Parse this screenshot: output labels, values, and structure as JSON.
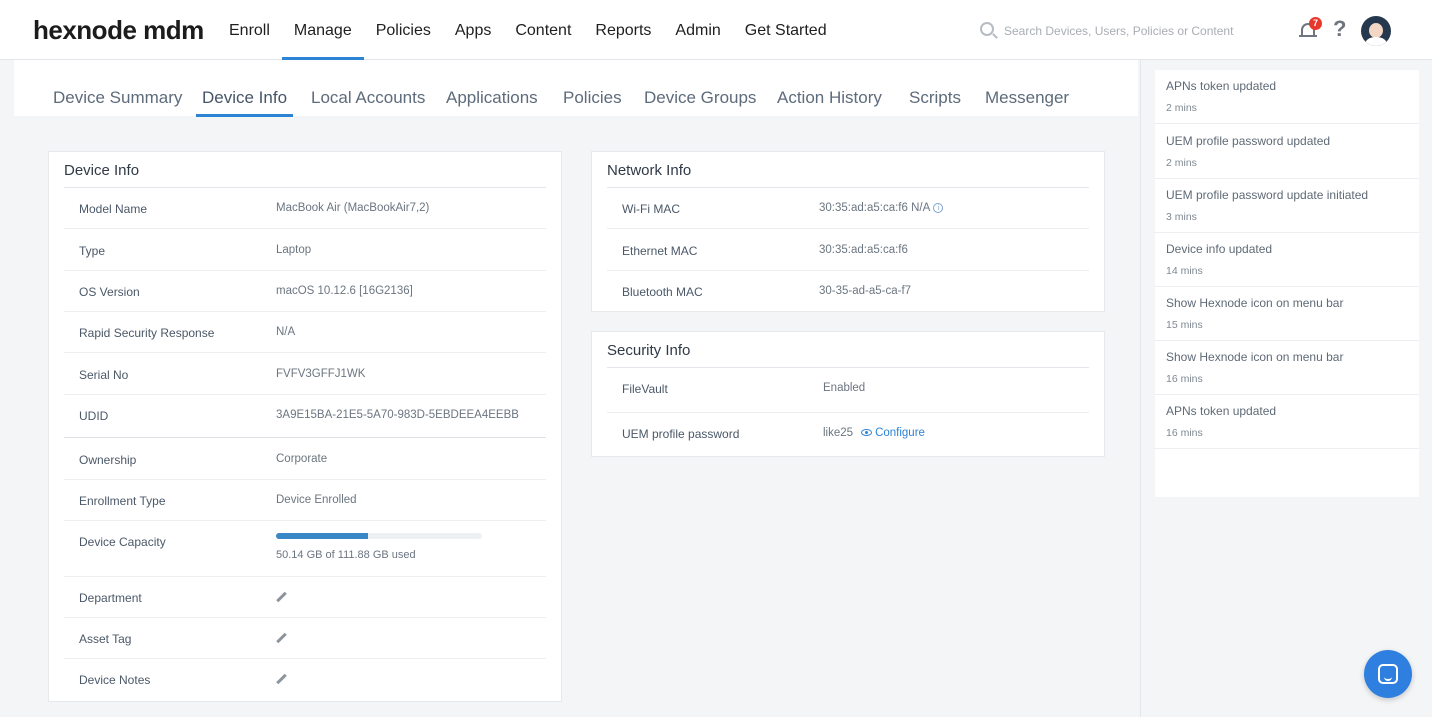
{
  "app": {
    "logo": "hexnode mdm"
  },
  "nav": {
    "items": [
      "Enroll",
      "Manage",
      "Policies",
      "Apps",
      "Content",
      "Reports",
      "Admin",
      "Get Started"
    ],
    "active": "Manage"
  },
  "search": {
    "placeholder": "Search Devices, Users, Policies or Content"
  },
  "header": {
    "notification_count": "7",
    "help": "?"
  },
  "tabs": [
    "Device Summary",
    "Device Info",
    "Local Accounts",
    "Applications",
    "Policies",
    "Device Groups",
    "Action History",
    "Scripts",
    "Messenger"
  ],
  "active_tab": "Device Info",
  "device_info": {
    "title": "Device Info",
    "rows": [
      {
        "label": "Model Name",
        "value": "MacBook Air (MacBookAir7,2)"
      },
      {
        "label": "Type",
        "value": "Laptop"
      },
      {
        "label": "OS Version",
        "value": "macOS 10.12.6 [16G2136]"
      },
      {
        "label": "Rapid Security Response",
        "value": "N/A"
      },
      {
        "label": "Serial No",
        "value": "FVFV3GFFJ1WK"
      },
      {
        "label": "UDID",
        "value": "3A9E15BA-21E5-5A70-983D-5EBDEEA4EEBB"
      },
      {
        "label": "Ownership",
        "value": "Corporate"
      },
      {
        "label": "Enrollment Type",
        "value": "Device Enrolled"
      }
    ],
    "capacity": {
      "label": "Device Capacity",
      "used_text": "50.14 GB of 111.88 GB used",
      "used_fraction": 0.448
    },
    "editable": [
      {
        "label": "Department"
      },
      {
        "label": "Asset Tag"
      },
      {
        "label": "Device Notes"
      }
    ]
  },
  "network_info": {
    "title": "Network Info",
    "rows": [
      {
        "label": "Wi-Fi MAC",
        "value": "30:35:ad:a5:ca:f6 N/A"
      },
      {
        "label": "Ethernet MAC",
        "value": "30:35:ad:a5:ca:f6"
      },
      {
        "label": "Bluetooth MAC",
        "value": "30-35-ad-a5-ca-f7"
      }
    ]
  },
  "security_info": {
    "title": "Security Info",
    "rows": [
      {
        "label": "FileVault",
        "value": "Enabled"
      },
      {
        "label": "UEM profile password",
        "value": "like25",
        "action": "Configure"
      }
    ]
  },
  "activity": [
    {
      "text": "APNs token updated",
      "time": "2 mins"
    },
    {
      "text": "UEM profile password updated",
      "time": "2 mins"
    },
    {
      "text": "UEM profile password update initiated",
      "time": "3 mins"
    },
    {
      "text": "Device info updated",
      "time": "14 mins"
    },
    {
      "text": "Show Hexnode icon on menu bar",
      "time": "15 mins"
    },
    {
      "text": "Show Hexnode icon on menu bar",
      "time": "16 mins"
    },
    {
      "text": "APNs token updated",
      "time": "16 mins"
    }
  ],
  "icons": {
    "search": "search-icon",
    "bell": "bell-icon",
    "help": "help-icon",
    "avatar": "avatar",
    "pencil": "pencil-icon",
    "info": "info-icon",
    "eye": "eye-icon",
    "chat": "chat-icon"
  },
  "colors": {
    "accent": "#2d83d4",
    "badge": "#e8372d",
    "chat": "#2f7fe0"
  }
}
